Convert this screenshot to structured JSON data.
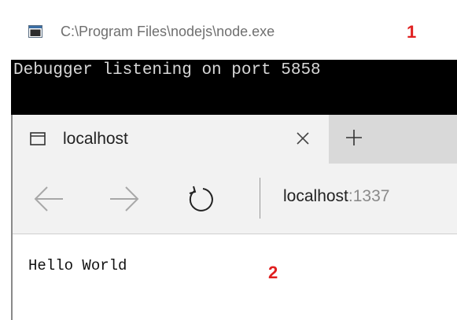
{
  "console": {
    "title": "C:\\Program Files\\nodejs\\node.exe",
    "icon": "console-window-icon",
    "output": "Debugger listening on port 5858"
  },
  "annotations": {
    "marker_1": "1",
    "marker_2": "2",
    "color": "#e02020"
  },
  "browser": {
    "tab": {
      "title": "localhost",
      "icon": "page-icon",
      "close_icon": "close-icon"
    },
    "new_tab_icon": "plus-icon",
    "nav": {
      "back_icon": "arrow-left-icon",
      "forward_icon": "arrow-right-icon",
      "refresh_icon": "refresh-icon"
    },
    "address": {
      "host": "localhost",
      "port": ":1337"
    },
    "page": {
      "text": "Hello World"
    }
  }
}
